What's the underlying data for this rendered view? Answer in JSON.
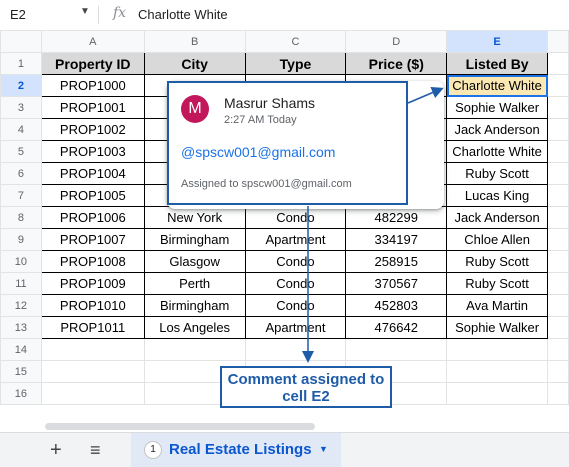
{
  "formula_bar": {
    "name_box": "E2",
    "fx": "fx",
    "value": "Charlotte White"
  },
  "columns": [
    "A",
    "B",
    "C",
    "D",
    "E"
  ],
  "row_numbers": [
    "1",
    "2",
    "3",
    "4",
    "5",
    "6",
    "7",
    "8",
    "9",
    "10",
    "11",
    "12",
    "13",
    "14",
    "15",
    "16"
  ],
  "table": {
    "headers": [
      "Property ID",
      "City",
      "Type",
      "Price ($)",
      "Listed By"
    ],
    "rows": [
      [
        "PROP1000",
        "",
        "",
        "",
        "Charlotte White"
      ],
      [
        "PROP1001",
        "",
        "",
        "",
        "Sophie Walker"
      ],
      [
        "PROP1002",
        "",
        "",
        "",
        "Jack Anderson"
      ],
      [
        "PROP1003",
        "",
        "",
        "",
        "Charlotte White"
      ],
      [
        "PROP1004",
        "",
        "",
        "",
        "Ruby Scott"
      ],
      [
        "PROP1005",
        "",
        "",
        "",
        "Lucas King"
      ],
      [
        "PROP1006",
        "New York",
        "Condo",
        "482299",
        "Jack Anderson"
      ],
      [
        "PROP1007",
        "Birmingham",
        "Apartment",
        "334197",
        "Chloe Allen"
      ],
      [
        "PROP1008",
        "Glasgow",
        "Condo",
        "258915",
        "Ruby Scott"
      ],
      [
        "PROP1009",
        "Perth",
        "Condo",
        "370567",
        "Ruby Scott"
      ],
      [
        "PROP1010",
        "Birmingham",
        "Condo",
        "452803",
        "Ava Martin"
      ],
      [
        "PROP1011",
        "Los Angeles",
        "Apartment",
        "476642",
        "Sophie Walker"
      ]
    ]
  },
  "comment": {
    "avatar_letter": "M",
    "author": "Masrur Shams",
    "time": "2:27 AM Today",
    "mention": "@spscw001@gmail.com",
    "assigned": "Assigned to spscw001@gmail.com"
  },
  "annotation": {
    "line1": "Comment assigned to",
    "line2": "cell E2"
  },
  "tabs": {
    "add_icon": "+",
    "menu_icon": "≡",
    "index": "1",
    "active_name": "Real Estate Listings"
  },
  "colors": {
    "accent": "#1a73e8",
    "annotation": "#1f5ca8",
    "header_fill": "#d9d9d9",
    "selected_fill": "#fce8b2",
    "avatar": "#c2185b"
  }
}
